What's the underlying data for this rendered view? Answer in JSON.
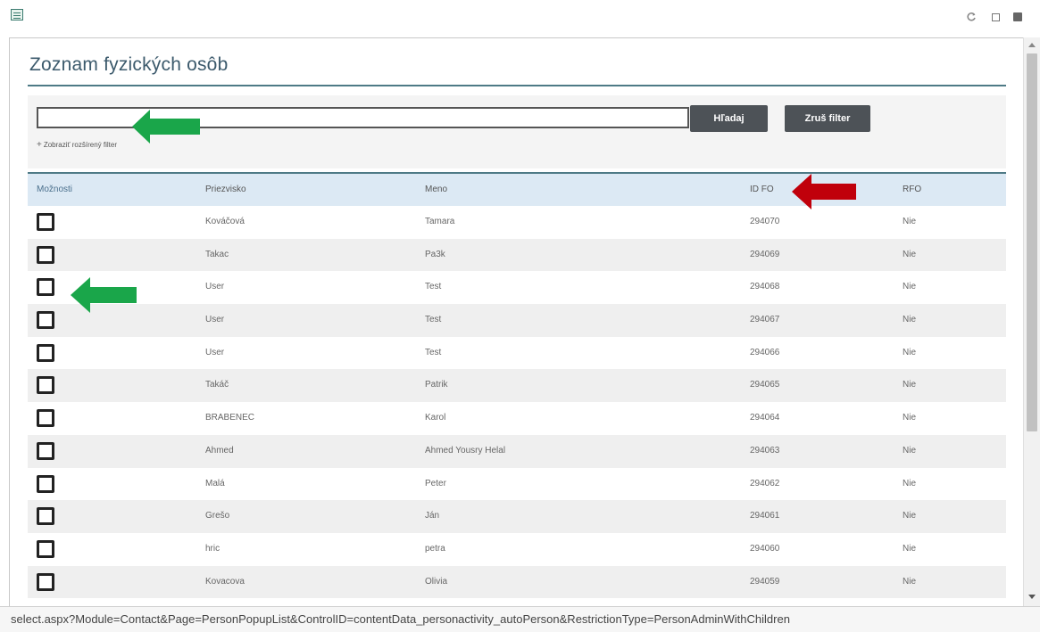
{
  "window": {
    "icons": [
      "app-icon",
      "refresh-icon",
      "restore-icon",
      "close-icon"
    ]
  },
  "page": {
    "title": "Zoznam fyzických osôb"
  },
  "filter": {
    "search_value": "",
    "search_label": "Hľadaj",
    "clear_label": "Zruš filter",
    "extended_plus": "+",
    "extended_label": "Zobraziť rozšírený filter"
  },
  "table": {
    "headers": {
      "options": "Možnosti",
      "surname": "Priezvisko",
      "name": "Meno",
      "id": "ID FO",
      "rfo": "RFO"
    },
    "rows": [
      {
        "surname": "Kováčová",
        "name": "Tamara",
        "id": "294070",
        "rfo": "Nie"
      },
      {
        "surname": "Takac",
        "name": "Pa3k",
        "id": "294069",
        "rfo": "Nie"
      },
      {
        "surname": "User",
        "name": "Test",
        "id": "294068",
        "rfo": "Nie"
      },
      {
        "surname": "User",
        "name": "Test",
        "id": "294067",
        "rfo": "Nie"
      },
      {
        "surname": "User",
        "name": "Test",
        "id": "294066",
        "rfo": "Nie"
      },
      {
        "surname": "Takáč",
        "name": "Patrik",
        "id": "294065",
        "rfo": "Nie"
      },
      {
        "surname": "BRABENEC",
        "name": "Karol",
        "id": "294064",
        "rfo": "Nie"
      },
      {
        "surname": "Ahmed",
        "name": "Ahmed Yousry Helal",
        "id": "294063",
        "rfo": "Nie"
      },
      {
        "surname": "Malá",
        "name": "Peter",
        "id": "294062",
        "rfo": "Nie"
      },
      {
        "surname": "Grešo",
        "name": "Ján",
        "id": "294061",
        "rfo": "Nie"
      },
      {
        "surname": "hric",
        "name": "petra",
        "id": "294060",
        "rfo": "Nie"
      },
      {
        "surname": "Kovacova",
        "name": "Olivia",
        "id": "294059",
        "rfo": "Nie"
      }
    ]
  },
  "annotations": {
    "green": "#1aa64a",
    "red": "#c0000b"
  },
  "statusbar": {
    "url": "select.aspx?Module=Contact&Page=PersonPopupList&ControlID=contentData_personactivity_autoPerson&RestrictionType=PersonAdminWithChildren"
  }
}
